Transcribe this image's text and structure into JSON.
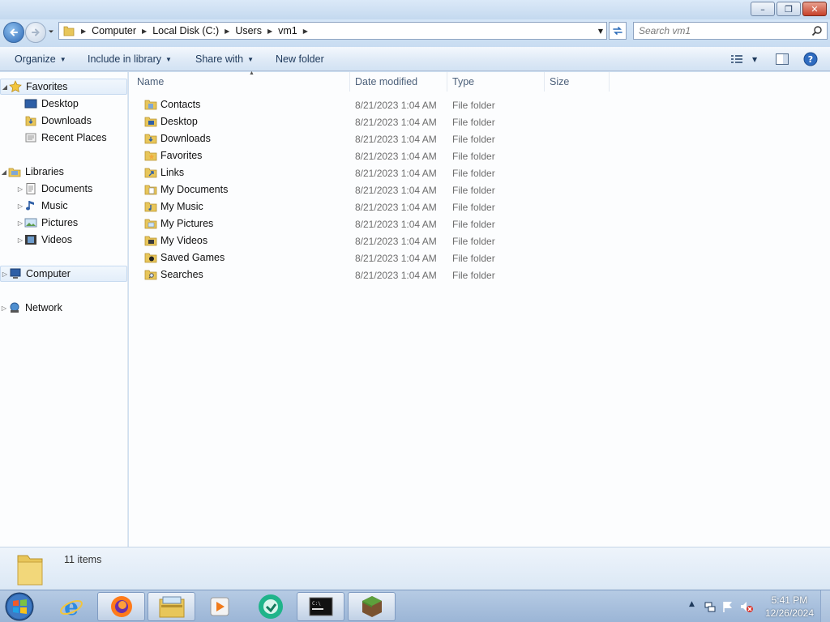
{
  "window": {
    "minimize_glyph": "–",
    "restore_glyph": "❐",
    "close_glyph": "✕"
  },
  "address": {
    "crumbs": [
      "Computer",
      "Local Disk (C:)",
      "Users",
      "vm1"
    ]
  },
  "search": {
    "placeholder": "Search vm1"
  },
  "toolbar": {
    "organize": "Organize",
    "include_in_library": "Include in library",
    "share_with": "Share with",
    "new_folder": "New folder"
  },
  "nav": {
    "favorites": {
      "label": "Favorites",
      "items": [
        "Desktop",
        "Downloads",
        "Recent Places"
      ]
    },
    "libraries": {
      "label": "Libraries",
      "items": [
        "Documents",
        "Music",
        "Pictures",
        "Videos"
      ]
    },
    "computer": "Computer",
    "network": "Network"
  },
  "columns": {
    "name": "Name",
    "date": "Date modified",
    "type": "Type",
    "size": "Size"
  },
  "files": [
    {
      "name": "Contacts",
      "date": "8/21/2023 1:04 AM",
      "type": "File folder",
      "icon": "contacts-folder-icon"
    },
    {
      "name": "Desktop",
      "date": "8/21/2023 1:04 AM",
      "type": "File folder",
      "icon": "desktop-folder-icon"
    },
    {
      "name": "Downloads",
      "date": "8/21/2023 1:04 AM",
      "type": "File folder",
      "icon": "downloads-folder-icon"
    },
    {
      "name": "Favorites",
      "date": "8/21/2023 1:04 AM",
      "type": "File folder",
      "icon": "favorites-folder-icon"
    },
    {
      "name": "Links",
      "date": "8/21/2023 1:04 AM",
      "type": "File folder",
      "icon": "links-folder-icon"
    },
    {
      "name": "My Documents",
      "date": "8/21/2023 1:04 AM",
      "type": "File folder",
      "icon": "documents-folder-icon"
    },
    {
      "name": "My Music",
      "date": "8/21/2023 1:04 AM",
      "type": "File folder",
      "icon": "music-folder-icon"
    },
    {
      "name": "My Pictures",
      "date": "8/21/2023 1:04 AM",
      "type": "File folder",
      "icon": "pictures-folder-icon"
    },
    {
      "name": "My Videos",
      "date": "8/21/2023 1:04 AM",
      "type": "File folder",
      "icon": "videos-folder-icon"
    },
    {
      "name": "Saved Games",
      "date": "8/21/2023 1:04 AM",
      "type": "File folder",
      "icon": "saved-games-folder-icon"
    },
    {
      "name": "Searches",
      "date": "8/21/2023 1:04 AM",
      "type": "File folder",
      "icon": "searches-folder-icon"
    }
  ],
  "status": {
    "item_count": "11 items"
  },
  "taskbar": {
    "apps": [
      "internet-explorer-icon",
      "firefox-icon",
      "windows-explorer-icon",
      "media-player-icon",
      "vpn-app-icon",
      "command-prompt-icon",
      "minecraft-icon"
    ],
    "clock_time": "5:41 PM",
    "clock_date": "12/26/2024"
  },
  "colors": {
    "accent": "#1e395b",
    "selection": "#e3eefa",
    "folder": "#e8c65a"
  }
}
